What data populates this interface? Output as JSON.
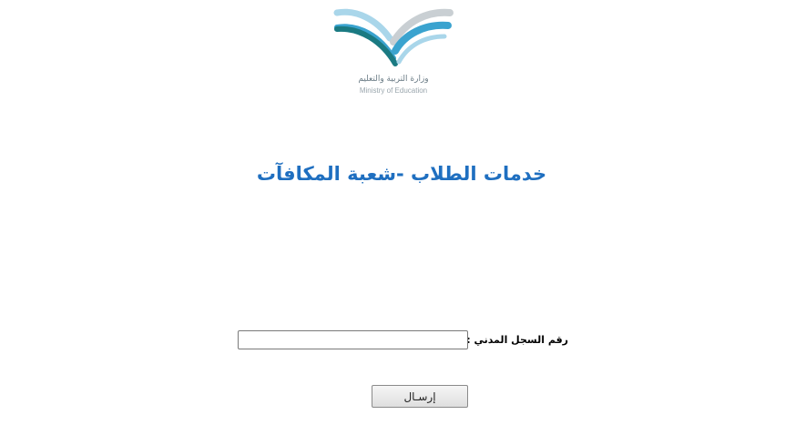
{
  "header": {
    "logo": {
      "icon": "open-book-icon",
      "arabic_text": "وزارة التربية والتعليم",
      "english_text": "Ministry of Education",
      "colors": {
        "teal": "#1a7a82",
        "blue": "#3aa3cf",
        "light_blue": "#a9d6ea",
        "grey": "#c9cfd3"
      }
    },
    "title": "خدمات الطلاب -شعبة المكافآت"
  },
  "form": {
    "civil_id_label": "رقم السجل المدني :",
    "civil_id_value": "",
    "submit_label": "إرسـال"
  },
  "colors": {
    "title": "#1f6fc0"
  }
}
